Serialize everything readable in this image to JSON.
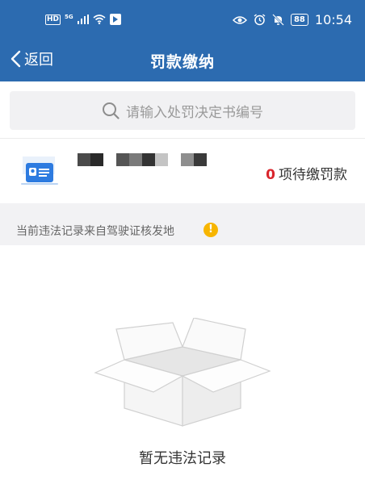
{
  "status_bar": {
    "network_badge": "HD",
    "network_type": "5G",
    "battery": "88",
    "time": "10:54"
  },
  "nav": {
    "back_label": "返回",
    "title": "罚款缴纳"
  },
  "search": {
    "placeholder": "请输入处罚决定书编号"
  },
  "summary": {
    "count": "0",
    "count_suffix": "项待缴罚款"
  },
  "notice": {
    "text": "当前违法记录来自驾驶证核发地",
    "icon": "!"
  },
  "empty_state": {
    "text": "暂无违法记录"
  },
  "colors": {
    "header": "#2c6bb0",
    "accent_red": "#d9252c",
    "warning": "#f7b500"
  }
}
